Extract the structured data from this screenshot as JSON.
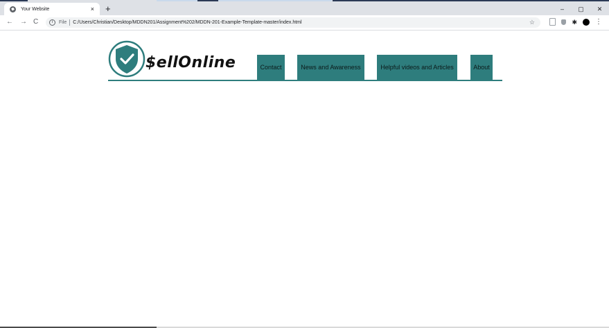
{
  "browser": {
    "tab_title": "Your Website",
    "tab_close": "×",
    "new_tab": "+",
    "url_scheme_label": "File",
    "url": "C:/Users/Christian/Desktop/MDDN201/Assignment%202/MDDN-201-Example-Template-master/index.html",
    "window_controls": {
      "minimize": "–",
      "restore": "▢",
      "close": "✕"
    },
    "nav": {
      "back": "←",
      "forward": "→",
      "reload": "C"
    },
    "star": "☆",
    "menu": "⋮",
    "puzzle": "✱"
  },
  "site": {
    "logo_text": "$ellOnline",
    "brand_color": "#2e7d7d",
    "nav_items": [
      {
        "label": "Contact"
      },
      {
        "label": "News and Awareness"
      },
      {
        "label": "Helpful videos and Articles"
      },
      {
        "label": "About"
      }
    ]
  }
}
